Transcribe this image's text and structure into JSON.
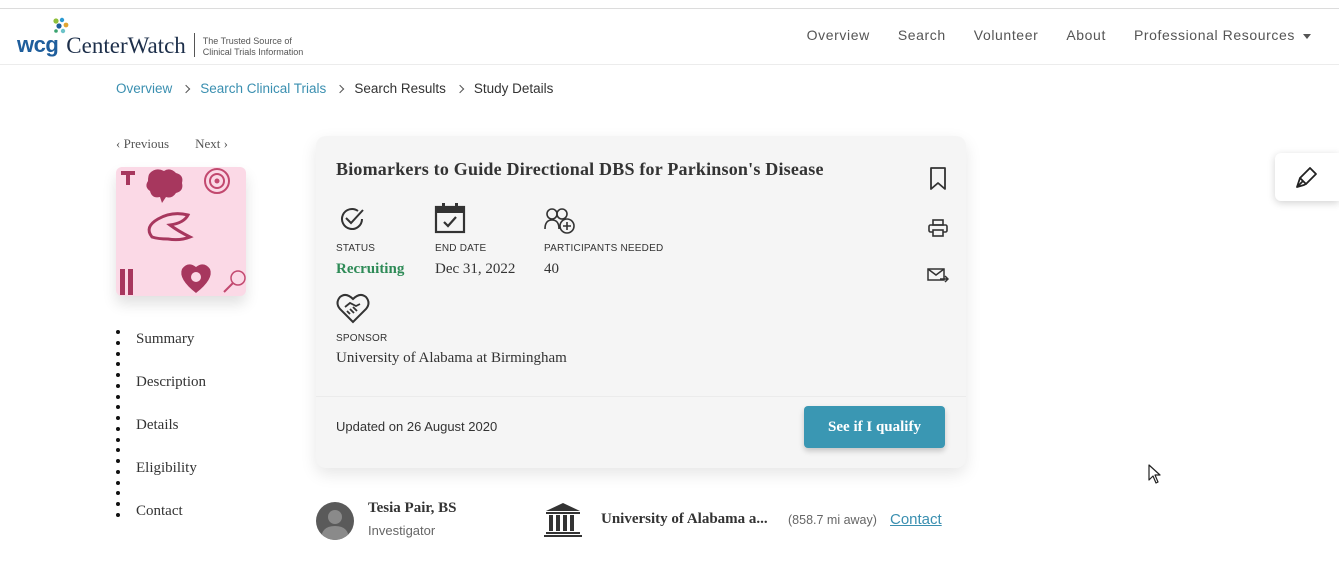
{
  "header": {
    "logo": {
      "wcg": "wcg",
      "brand": "CenterWatch",
      "tagline_line1": "The Trusted Source of",
      "tagline_line2": "Clinical Trials Information"
    },
    "nav": [
      {
        "label": "Overview"
      },
      {
        "label": "Search"
      },
      {
        "label": "Volunteer"
      },
      {
        "label": "About"
      },
      {
        "label": "Professional Resources"
      }
    ]
  },
  "breadcrumb": [
    {
      "label": "Overview",
      "link": true
    },
    {
      "label": "Search Clinical Trials",
      "link": true
    },
    {
      "label": "Search Results",
      "link": false
    },
    {
      "label": "Study Details",
      "link": false
    }
  ],
  "pager": {
    "previous": "Previous",
    "next": "Next"
  },
  "toc": [
    "Summary",
    "Description",
    "Details",
    "Eligibility",
    "Contact"
  ],
  "study": {
    "title": "Biomarkers to Guide Directional DBS for Parkinson's Disease",
    "status_label": "STATUS",
    "status_value": "Recruiting",
    "end_date_label": "END DATE",
    "end_date_value": "Dec 31, 2022",
    "participants_label": "PARTICIPANTS NEEDED",
    "participants_value": "40",
    "sponsor_label": "SPONSOR",
    "sponsor_value": "University of Alabama at Birmingham",
    "updated": "Updated on 26 August 2020",
    "qualify_button": "See if I qualify"
  },
  "investigator": {
    "name": "Tesia Pair, BS",
    "role": "Investigator"
  },
  "site": {
    "name": "University of Alabama a...",
    "distance": "(858.7 mi away)",
    "contact": "Contact"
  },
  "colors": {
    "accent": "#3a97b3",
    "link": "#3a8fb0",
    "recruiting": "#2e8b57",
    "thumb_bg": "#fbd9e6"
  }
}
